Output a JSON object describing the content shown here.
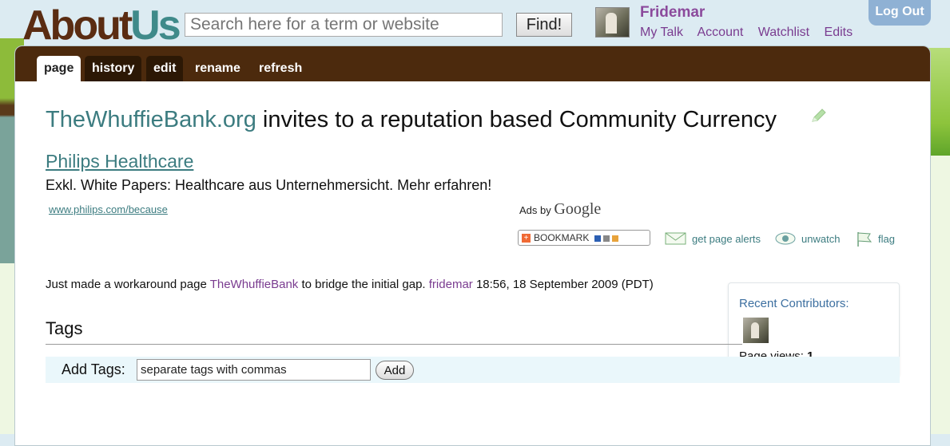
{
  "header": {
    "logo_part1": "About",
    "logo_part2": "Us",
    "search_placeholder": "Search here for a term or website",
    "find_label": "Find!",
    "username": "Fridemar",
    "user_links": [
      "My Talk",
      "Account",
      "Watchlist",
      "Edits"
    ],
    "logout_label": "Log Out"
  },
  "tabs": [
    {
      "label": "page",
      "active": true
    },
    {
      "label": "history"
    },
    {
      "label": "edit"
    },
    {
      "label": "rename"
    },
    {
      "label": "refresh"
    }
  ],
  "page": {
    "title_site": "TheWhuffieBank.org",
    "title_rest": " invites to a reputation based Community Currency"
  },
  "ad": {
    "title": "Philips Healthcare",
    "description": "Exkl. White Papers: Healthcare aus Unternehmersicht. Mehr erfahren!",
    "url": "www.philips.com/because",
    "ads_by": "Ads by",
    "google": "Google"
  },
  "actions": {
    "bookmark": "BOOKMARK",
    "alerts": "get page alerts",
    "unwatch": "unwatch",
    "flag": "flag"
  },
  "note": {
    "text1": "Just made a workaround page ",
    "link1": "TheWhuffieBank",
    "text2": " to bridge the initial gap. ",
    "user": "fridemar",
    "time": " 18:56, 18 September 2009 (PDT)"
  },
  "sidebar": {
    "contributors_title": "Recent Contributors:",
    "views_label": "Page views: ",
    "views_value": "1"
  },
  "tags": {
    "heading": "Tags",
    "add_label": "Add Tags:",
    "input_value": "separate tags with commas",
    "add_button": "Add"
  },
  "colors": {
    "tab_bar": "#4c2a0d",
    "link": "#3c7c80",
    "user": "#8b4a9c"
  }
}
